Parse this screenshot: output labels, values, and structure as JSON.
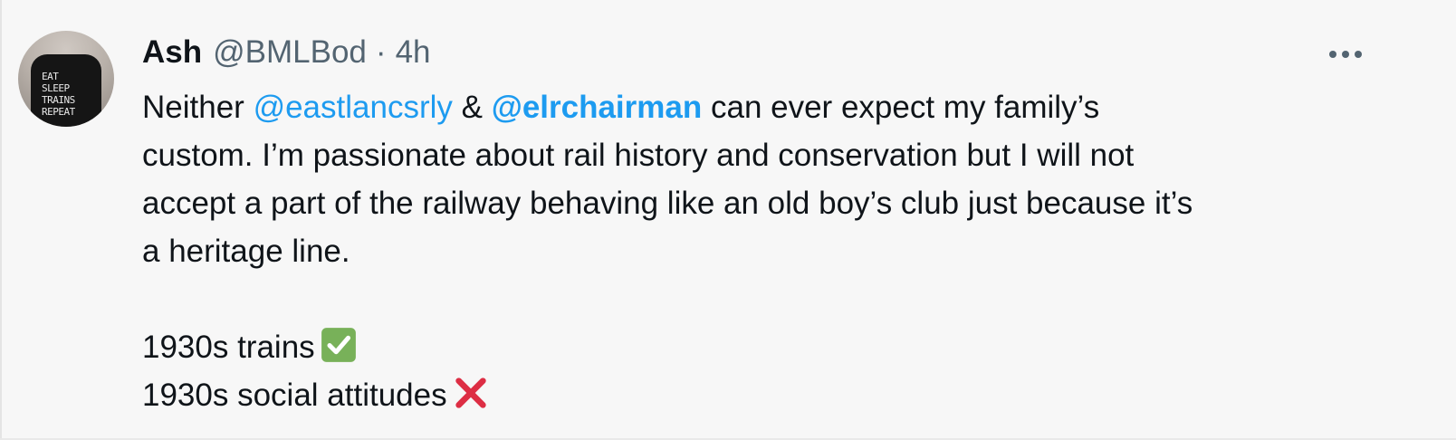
{
  "tweet": {
    "author_name": "Ash",
    "handle": "@BMLBod",
    "separator": "·",
    "time": "4h",
    "avatar_shirt_text": "EAT\nSLEEP\nTRAINS\nREPEAT",
    "text": {
      "l1_pre": "Neither ",
      "mention1": "@eastlancsrly",
      "l1_mid": " & ",
      "mention2": "@elrchairman",
      "l1_post": " can ever expect my family’s",
      "l2": "custom. I’m passionate about rail history and conservation but I will not",
      "l3": "accept a part of the railway behaving like an old boy’s club just because it’s",
      "l4": "a heritage line.",
      "l6": "1930s trains",
      "l7": "1930s social attitudes"
    },
    "emoji": {
      "check": "white-heavy-check-mark",
      "cross": "cross-mark"
    }
  },
  "colors": {
    "background": "#f7f7f7",
    "text": "#0f1419",
    "secondary": "#536471",
    "link": "#1d9bf0",
    "check_green": "#78b159",
    "cross_red": "#dd2e44"
  }
}
